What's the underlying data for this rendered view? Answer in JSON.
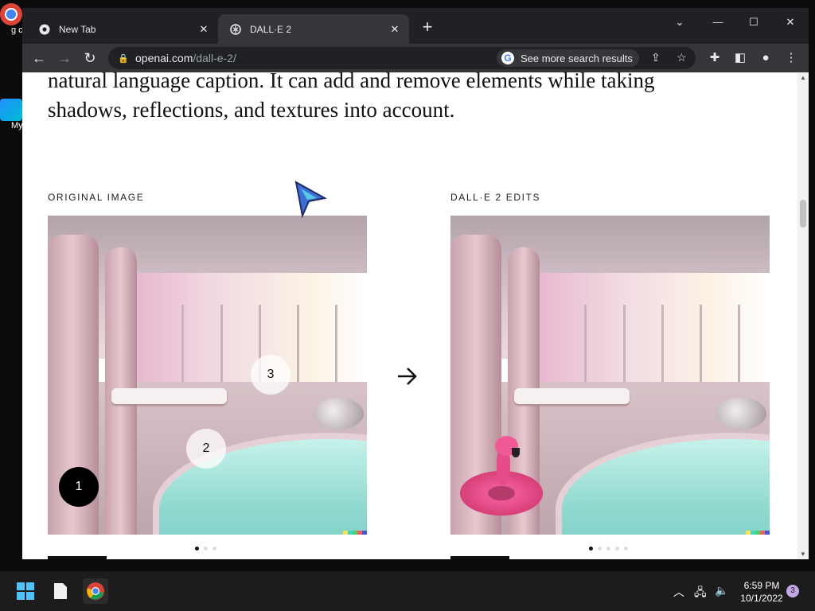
{
  "browser": {
    "tabs": [
      {
        "title": "New Tab",
        "active": false
      },
      {
        "title": "DALL·E 2",
        "active": true
      }
    ],
    "url": {
      "domain": "openai.com",
      "path": "/dall-e-2/"
    },
    "search_chip": "See more search results"
  },
  "page": {
    "paragraph": "natural language caption. It can add and remove elements while taking shadows, reflections, and textures into account.",
    "left_label": "ORIGINAL IMAGE",
    "right_label": "DALL·E 2 EDITS",
    "markers": [
      {
        "label": "1",
        "style": "dark"
      },
      {
        "label": "2",
        "style": "light"
      },
      {
        "label": "3",
        "style": "light"
      }
    ],
    "arrow_icon": "arrow-right-icon",
    "left_dots": 3,
    "left_active_dot": 0,
    "right_dots": 5,
    "right_active_dot": 0
  },
  "desktop": {
    "icon_labels": [
      "g ch",
      "My G - S"
    ]
  },
  "taskbar": {
    "time": "6:59 PM",
    "date": "10/1/2022",
    "notification_count": "3"
  },
  "colors": {
    "tab_bar": "#202124",
    "toolbar": "#35363a",
    "taskbar": "#1c1c1c",
    "notification_badge": "#c3a6e6"
  }
}
